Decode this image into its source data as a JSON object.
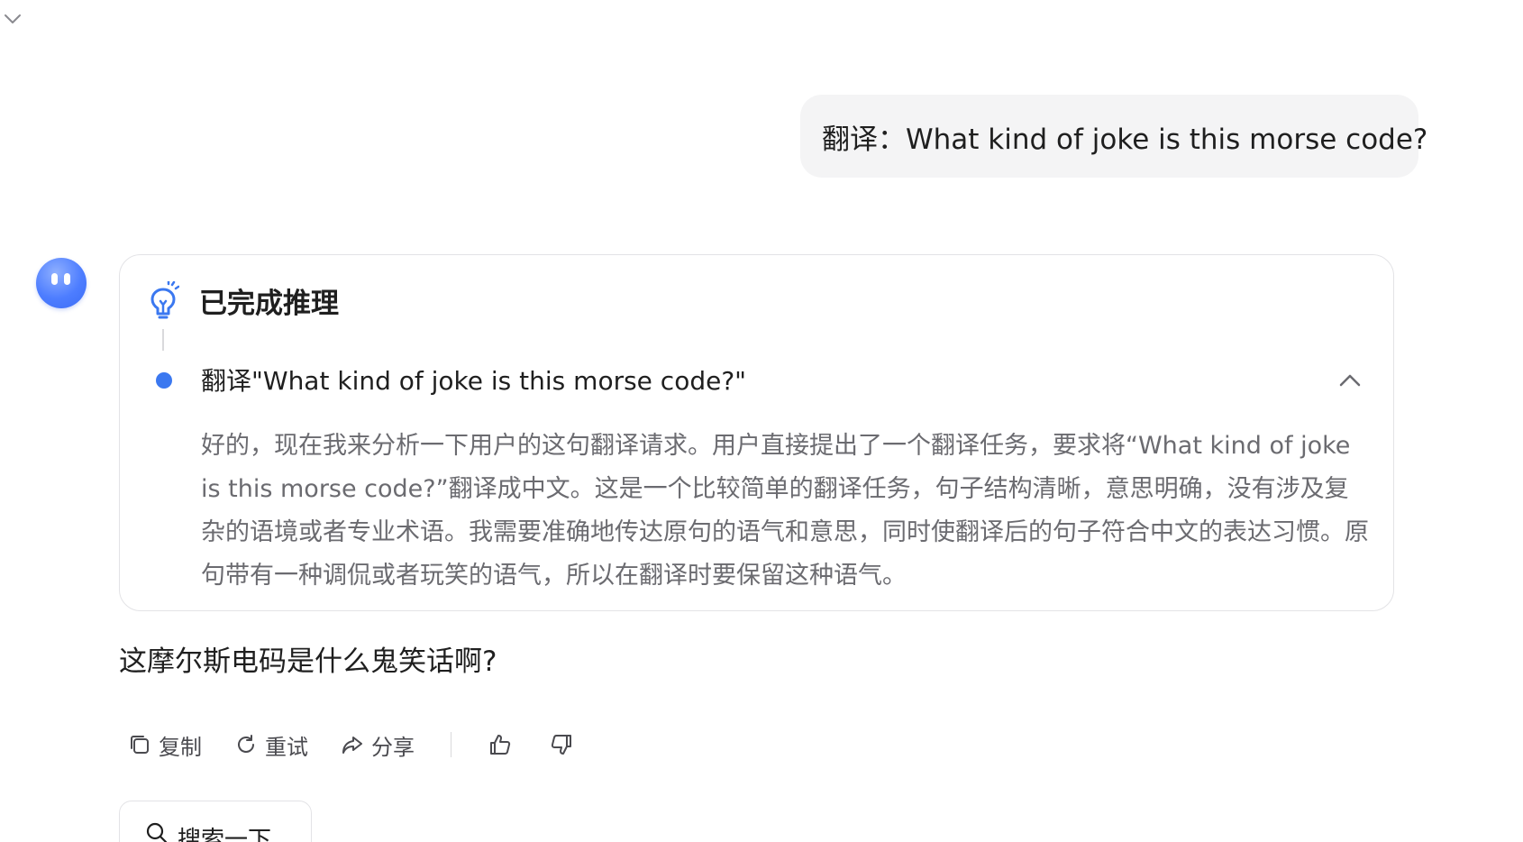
{
  "user_message": {
    "text": "翻译：What kind of joke is this morse code?"
  },
  "reasoning": {
    "title": "已完成推理",
    "step_title": "翻译\"What kind of joke is this morse code?\"",
    "body": "好的，现在我来分析一下用户的这句翻译请求。用户直接提出了一个翻译任务，要求将“What kind of joke is this morse code?”翻译成中文。这是一个比较简单的翻译任务，句子结构清晰，意思明确，没有涉及复杂的语境或者专业术语。我需要准确地传达原句的语气和意思，同时使翻译后的句子符合中文的表达习惯。原句带有一种调侃或者玩笑的语气，所以在翻译时要保留这种语气。"
  },
  "answer": {
    "text": "这摩尔斯电码是什么鬼笑话啊?"
  },
  "actions": {
    "copy_label": "复制",
    "retry_label": "重试",
    "share_label": "分享"
  },
  "search": {
    "label": "搜索一下"
  },
  "icons": {
    "collapse": "chevron-down-icon",
    "bulb": "lightbulb-icon",
    "step_toggle": "chevron-up-icon",
    "copy": "copy-icon",
    "retry": "refresh-icon",
    "share": "share-icon",
    "like": "thumbs-up-icon",
    "dislike": "thumbs-down-icon",
    "search": "search-icon"
  },
  "colors": {
    "accent": "#3b78f0",
    "user_bubble_bg": "#f4f4f5",
    "reasoning_text": "#6b6b70"
  }
}
